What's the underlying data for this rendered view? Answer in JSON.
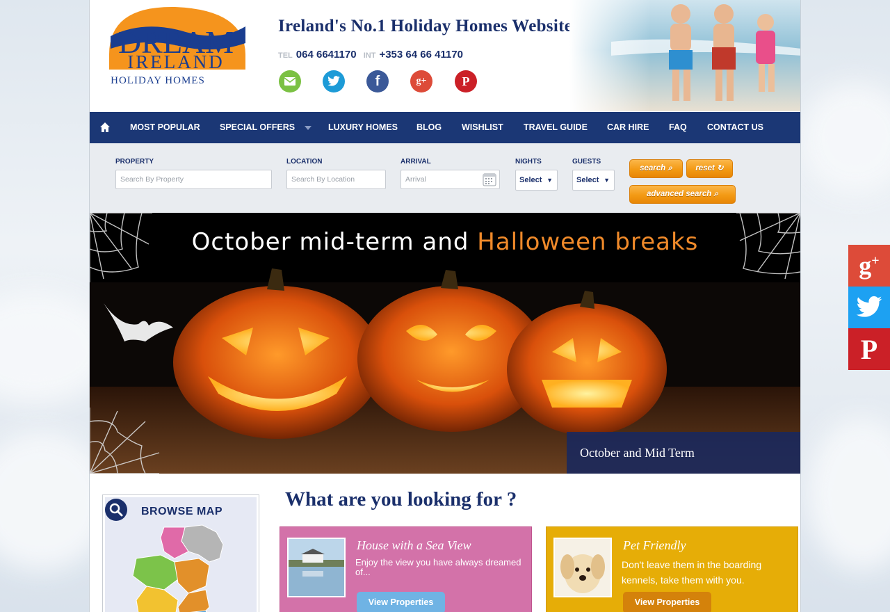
{
  "header": {
    "logo": {
      "line1": "DREAM",
      "line2": "IRELAND",
      "line3": "HOLIDAY HOMES"
    },
    "tagline": "Ireland's No.1 Holiday Homes Website",
    "phone": {
      "tel_label": "TEL",
      "tel_number": "064 6641170",
      "int_label": "INT",
      "int_number": "+353 64 66 41170"
    },
    "social_icons": [
      "email-icon",
      "twitter-icon",
      "facebook-icon",
      "google-plus-icon",
      "pinterest-icon"
    ]
  },
  "nav": {
    "home_icon": "home-icon",
    "items": [
      "MOST POPULAR",
      "SPECIAL OFFERS",
      "LUXURY HOMES",
      "BLOG",
      "WISHLIST",
      "TRAVEL GUIDE",
      "CAR HIRE",
      "FAQ",
      "CONTACT US"
    ]
  },
  "search": {
    "property_label": "PROPERTY",
    "property_placeholder": "Search By Property",
    "location_label": "LOCATION",
    "location_placeholder": "Search By Location",
    "arrival_label": "ARRIVAL",
    "arrival_placeholder": "Arrival",
    "nights_label": "NIGHTS",
    "nights_value": "Select",
    "guests_label": "GUESTS",
    "guests_value": "Select",
    "search_button": "search",
    "reset_button": "reset",
    "advanced_button": "advanced search"
  },
  "banner": {
    "title_part1": "October mid-term and",
    "title_part2": "Halloween breaks",
    "caption": "October and Mid Term"
  },
  "map": {
    "title": "BROWSE MAP"
  },
  "main": {
    "heading": "What are you looking for ?",
    "cards": [
      {
        "title": "House with a Sea View",
        "description": "Enjoy the view you have always dreamed of...",
        "button": "View Properties",
        "color": "#d9609f"
      },
      {
        "title": "Pet Friendly",
        "description": "Don't leave them in the boarding kennels, take them with you.",
        "button": "View Properties",
        "color": "#e6ad07"
      }
    ]
  },
  "side_share": [
    "google-plus-icon",
    "twitter-icon",
    "pinterest-icon"
  ],
  "colors": {
    "navy": "#1b3775",
    "orange": "#f39a14",
    "google": "#dd4b39",
    "twitter": "#1da1f2",
    "pinterest": "#cb2027"
  }
}
